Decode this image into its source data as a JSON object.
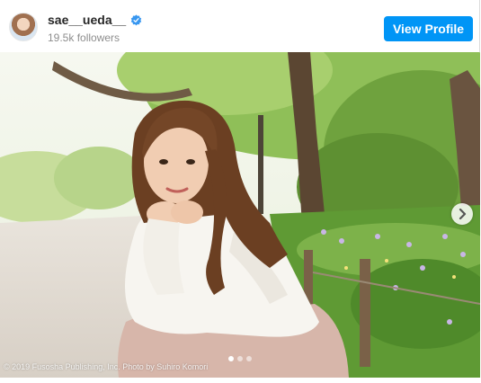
{
  "profile": {
    "username": "sae__ueda__",
    "verified_icon": "verified-badge-icon",
    "followers": "19.5k followers",
    "view_profile_label": "View Profile",
    "accent": "#0095f6"
  },
  "carousel": {
    "slide_count": 3,
    "active_index": 0,
    "next_icon": "chevron-right-icon",
    "credit": "© 2019 Fusosha Publishing, Inc. Photo by Suhiro Komori"
  }
}
